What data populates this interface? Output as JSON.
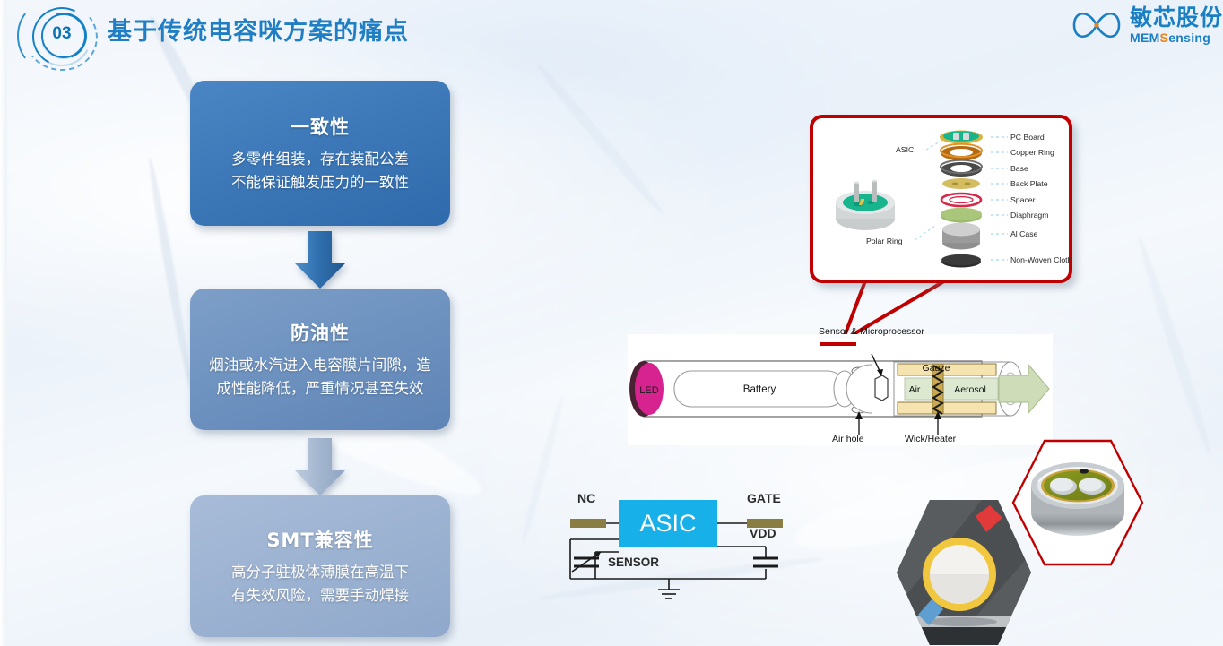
{
  "header": {
    "badge_number": "03",
    "title": "基于传统电容咪方案的痛点",
    "logo_cn": "敏芯股份",
    "logo_en_blue": "MEM",
    "logo_en_orange": "S",
    "logo_en_blue2": "ensing",
    "accent_color": "#1f7ec4"
  },
  "cards": [
    {
      "title": "一致性",
      "line1": "多零件组装，存在装配公差",
      "line2": "不能保证触发压力的一致性",
      "color": "#3d78b8"
    },
    {
      "title": "防油性",
      "line1": "烟油或水汽进入电容膜片间隙，造",
      "line2": "成性能降低，严重情况甚至失效",
      "color": "#6f93c0"
    },
    {
      "title": "SMT兼容性",
      "line1": "高分子驻极体薄膜在高温下",
      "line2": "有失效风险，需要手动焊接",
      "color": "#9db3d2"
    }
  ],
  "arrows": [
    {
      "name": "arrow-1",
      "color": "#36699f"
    },
    {
      "name": "arrow-2",
      "color": "#a9bcd4"
    }
  ],
  "callout": {
    "border_color": "#c00000",
    "assembly_labels": [
      "ASIC",
      "Polar Ring"
    ],
    "stack_labels": [
      "PC Board",
      "Copper Ring",
      "Base",
      "Back Plate",
      "Spacer",
      "Diaphragm",
      "Al Case",
      "Non-Woven Cloth"
    ],
    "stack_colors": [
      "#1aa784",
      "#b56a12",
      "#4a4a4a",
      "#d4b24a",
      "#d4294b",
      "#9bb96a",
      "#b8b8b8",
      "#2b2b2b"
    ]
  },
  "ecig": {
    "labels": {
      "led": "LED",
      "battery": "Battery",
      "sensor": "Sensor & Microprocessor",
      "air_hole": "Air hole",
      "gauze": "Gauze",
      "air": "Air",
      "aerosol": "Aerosol",
      "wick": "Wick/Heater"
    },
    "led_color": "#d6238f",
    "underline_color": "#c00000"
  },
  "circuit": {
    "chip_label": "ASIC",
    "chip_color": "#17b0e8",
    "pins": [
      "NC",
      "GATE",
      "VDD"
    ],
    "sensor_label": "SENSOR"
  }
}
